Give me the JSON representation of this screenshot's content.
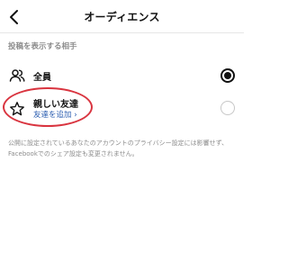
{
  "header": {
    "title": "オーディエンス",
    "back_icon": "chevron-left-icon"
  },
  "section": {
    "heading": "投稿を表示する相手"
  },
  "options": [
    {
      "label": "全員",
      "icon": "people-icon",
      "selected": true
    },
    {
      "label": "親しい友達",
      "icon": "star-icon",
      "sublink": "友達を追加 ›",
      "selected": false
    }
  ],
  "footnote": "公開に設定されているあなたのアカウントのプライバシー設定には影響せず、Facebookでのシェア設定も変更されません。",
  "colors": {
    "accent_link": "#2a5db0",
    "highlight": "#d9343f",
    "muted_text": "#8c8c8c"
  }
}
